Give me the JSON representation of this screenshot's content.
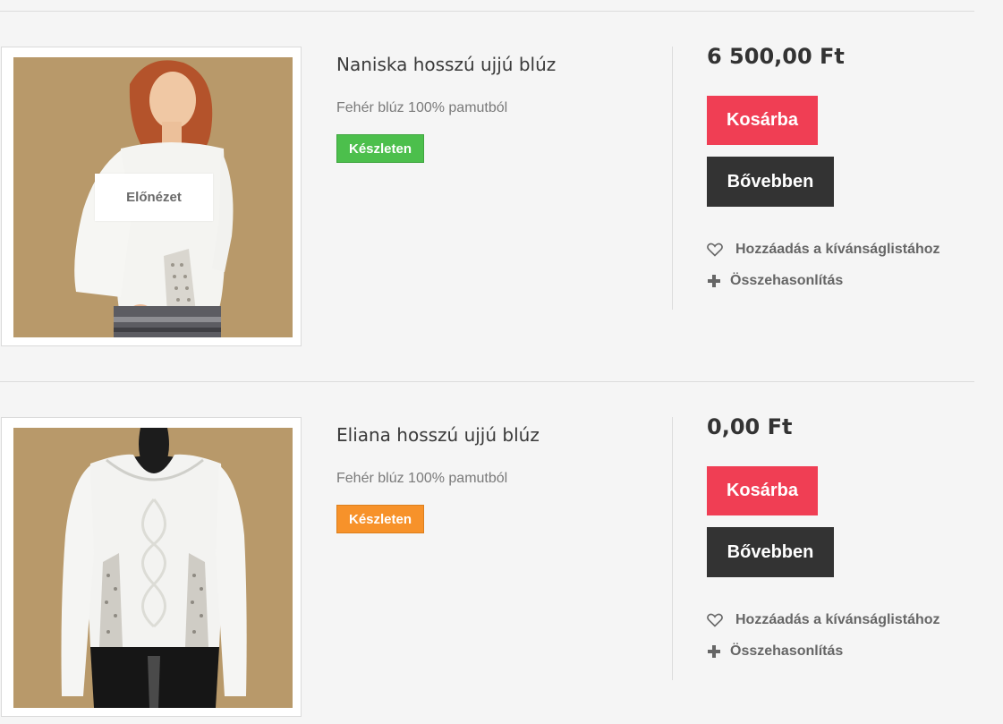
{
  "products": [
    {
      "title": "Naniska hosszú ujjú blúz",
      "description": "Fehér blúz 100% pamutból",
      "stock_label": "Készleten",
      "stock_color": "#4cbf4c",
      "price": "6 500,00 Ft",
      "preview_label": "Előnézet",
      "cart_label": "Kosárba",
      "more_label": "Bővebben",
      "wishlist_label": "Hozzáadás a kívánságlistához",
      "compare_label": "Összehasonlítás",
      "wishlist_icon": "heart-icon",
      "compare_icon": "plus-icon"
    },
    {
      "title": "Eliana hosszú ujjú blúz",
      "description": "Fehér blúz 100% pamutból",
      "stock_label": "Készleten",
      "stock_color": "#f7922a",
      "price": "0,00 Ft",
      "cart_label": "Kosárba",
      "more_label": "Bővebben",
      "wishlist_label": "Hozzáadás a kívánságlistához",
      "compare_label": "Összehasonlítás",
      "wishlist_icon": "heart-icon",
      "compare_icon": "plus-icon"
    }
  ],
  "colors": {
    "cart_button": "#f03e54",
    "more_button": "#333333",
    "image_background": "#b8996a"
  }
}
